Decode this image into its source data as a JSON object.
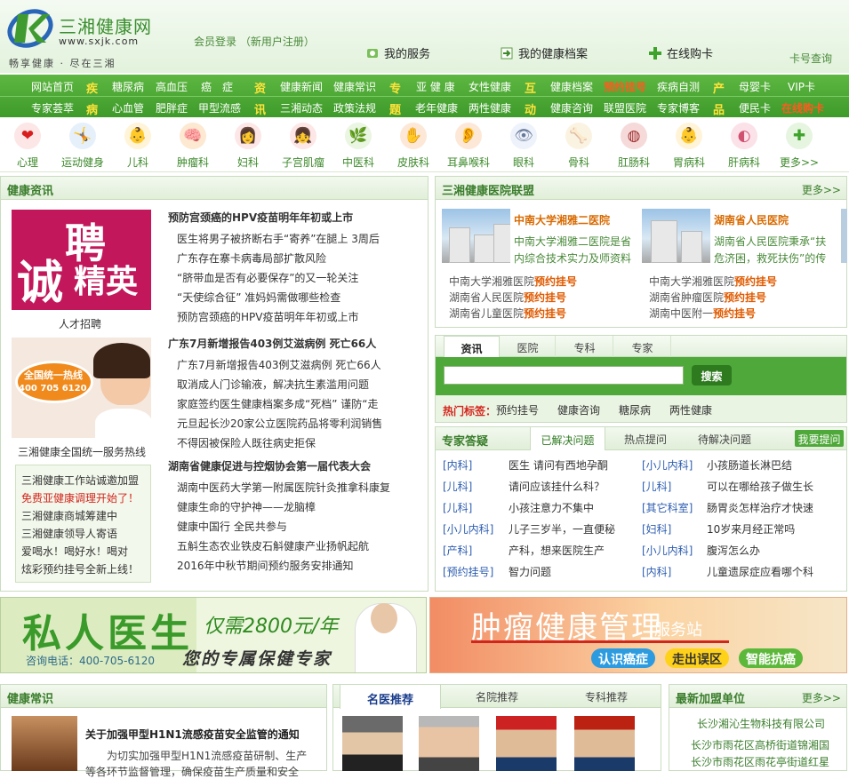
{
  "header": {
    "site_name": "三湘健康网",
    "url_text": "www.sxjk.com",
    "slogan": "畅享健康 · 尽在三湘",
    "member_text": "会员登录 （新用户注册）",
    "links": [
      "我的服务",
      "我的健康档案",
      "在线购卡"
    ],
    "card_query": "卡号查询"
  },
  "nav": {
    "row1": [
      "网站首页",
      "疾",
      "糖尿病",
      "高血压",
      "癌　症",
      "资",
      "健康新闻",
      "健康常识",
      "专",
      "亚 健 康",
      "女性健康",
      "互",
      "健康档案",
      "预约挂号",
      "疾病自测",
      "产",
      "母婴卡",
      "VIP卡"
    ],
    "row2": [
      "专家荟萃",
      "病",
      "心血管",
      "肥胖症",
      "甲型流感",
      "讯",
      "三湘动态",
      "政策法规",
      "题",
      "老年健康",
      "两性健康",
      "动",
      "健康咨询",
      "联盟医院",
      "专家博客",
      "品",
      "便民卡",
      "在线购卡"
    ]
  },
  "departments": [
    {
      "label": "心理",
      "icon": "heart-icon",
      "glyph": "❤"
    },
    {
      "label": "运动健身",
      "icon": "fitness-icon",
      "glyph": "🤸"
    },
    {
      "label": "儿科",
      "icon": "baby-icon",
      "glyph": "👶"
    },
    {
      "label": "肿瘤科",
      "icon": "tumor-icon",
      "glyph": "🧠"
    },
    {
      "label": "妇科",
      "icon": "woman-icon",
      "glyph": "👩"
    },
    {
      "label": "子宫肌瘤",
      "icon": "uterus-icon",
      "glyph": "👧"
    },
    {
      "label": "中医科",
      "icon": "herb-icon",
      "glyph": "🌿"
    },
    {
      "label": "皮肤科",
      "icon": "skin-icon",
      "glyph": "✋"
    },
    {
      "label": "耳鼻喉科",
      "icon": "ear-icon",
      "glyph": "👂"
    },
    {
      "label": "眼科",
      "icon": "eye-icon",
      "glyph": "👁"
    },
    {
      "label": "骨科",
      "icon": "bone-icon",
      "glyph": "🦴"
    },
    {
      "label": "肛肠科",
      "icon": "intestine-icon",
      "glyph": "◍"
    },
    {
      "label": "胃病科",
      "icon": "stomach-icon",
      "glyph": "👶"
    },
    {
      "label": "肝病科",
      "icon": "liver-icon",
      "glyph": "◐"
    },
    {
      "label": "更多>>",
      "icon": "plus-icon",
      "glyph": "✚"
    }
  ],
  "health_news": {
    "title": "健康资讯",
    "recruit": {
      "big1": "聘",
      "big2": "诚",
      "big3": "精英",
      "caption": "人才招聘"
    },
    "hotline": {
      "line1": "全国统一热线",
      "line2": "400 705 6120",
      "caption": "三湘健康全国统一服务热线"
    },
    "notices": [
      {
        "text": "三湘健康工作站诚邀加盟",
        "color": "#333"
      },
      {
        "text": "免费亚健康调理开始了！",
        "color": "#d4251c"
      },
      {
        "text": "三湘健康商城筹建中",
        "color": "#333"
      },
      {
        "text": "三湘健康领导人寄语",
        "color": "#333"
      },
      {
        "text": "爱喝水！喝好水！喝对",
        "color": "#333"
      },
      {
        "text": "炫彩预约挂号全新上线！",
        "color": "#333"
      }
    ],
    "groups": [
      {
        "head": "预防宫颈癌的HPV疫苗明年年初或上市",
        "items": [
          "医生将男子被挤断右手“寄养”在腿上 3周后",
          "广东存在寨卡病毒局部扩散风险",
          "“脐带血是否有必要保存”的又一轮关注",
          "“天使综合征” 准妈妈需做哪些检查",
          "预防宫颈癌的HPV疫苗明年年初或上市"
        ]
      },
      {
        "head": "广东7月新增报告403例艾滋病例 死亡66人",
        "items": [
          "广东7月新增报告403例艾滋病例 死亡66人",
          "取消成人门诊输液，解决抗生素滥用问题",
          "家庭签约医生健康档案多成“死档” 谨防“走",
          "元旦起长沙20家公立医院药品将零利润销售",
          "不得因被保险人既往病史拒保"
        ]
      },
      {
        "head": "湖南省健康促进与控烟协会第一届代表大会",
        "items": [
          "湖南中医药大学第一附属医院针灸推拿科康复",
          "健康生命的守护神——龙脑樟",
          "健康中国行 全民共参与",
          "五斛生态农业铁皮石斛健康产业扬帆起航",
          "2016年中秋节期间预约服务安排通知"
        ]
      }
    ]
  },
  "alliance": {
    "title": "三湘健康医院联盟",
    "more": "更多>>",
    "hospitals": [
      {
        "name": "中南大学湘雅二医院",
        "desc1": "中南大学湘雅二医院是省",
        "desc2": "内综合技术实力及师资料"
      },
      {
        "name": "湖南省人民医院",
        "desc1": "湖南省人民医院秉承“扶",
        "desc2": "危济困，救死扶伤”的传"
      }
    ],
    "booking": [
      [
        "中南大学湘雅医院",
        "中南大学湘雅医院"
      ],
      [
        "湖南省人民医院",
        "湖南省肿瘤医院"
      ],
      [
        "湖南省儿童医院",
        "湖南中医附一"
      ]
    ],
    "booking_label": "预约挂号"
  },
  "search": {
    "tabs": [
      "资讯",
      "医院",
      "专科",
      "专家"
    ],
    "button": "搜索",
    "value": "",
    "hot_label": "热门标签：",
    "hot_tags": [
      "预约挂号",
      "健康咨询",
      "糖尿病",
      "两性健康"
    ]
  },
  "qa": {
    "title": "专家答疑",
    "tabs": [
      "已解决问题",
      "热点提问",
      "待解决问题"
    ],
    "ask_button": "我要提问",
    "left": [
      {
        "cat": "[内科]",
        "q": "医生 请问有西地孕酮"
      },
      {
        "cat": "[儿科]",
        "q": "请问应该挂什么科？"
      },
      {
        "cat": "[儿科]",
        "q": "小孩注意力不集中"
      },
      {
        "cat": "[小儿内科]",
        "q": "儿子三岁半，一直便秘"
      },
      {
        "cat": "[产科]",
        "q": "产科，想来医院生产"
      },
      {
        "cat": "[预约挂号]",
        "q": "智力问题"
      }
    ],
    "right": [
      {
        "cat": "[小儿内科]",
        "q": "小孩肠道长淋巴结"
      },
      {
        "cat": "[儿科]",
        "q": "可以在哪给孩子做生长"
      },
      {
        "cat": "[其它科室]",
        "q": "肠胃炎怎样治疗才快速"
      },
      {
        "cat": "[妇科]",
        "q": "10岁来月经正常吗"
      },
      {
        "cat": "[小儿内科]",
        "q": "腹泻怎么办"
      },
      {
        "cat": "[内科]",
        "q": "儿童遗尿症应看哪个科"
      }
    ]
  },
  "banners": {
    "doctor": {
      "title": "私人医生",
      "price": "仅需2800元/年",
      "phone": "咨询电话：400-705-6120",
      "slogan": "您的专属保健专家"
    },
    "tumor": {
      "title": "肿瘤健康管理",
      "suffix": "服务站",
      "pills": [
        "认识癌症",
        "走出误区",
        "智能抗癌"
      ]
    }
  },
  "common_sense": {
    "title": "健康常识",
    "headline": "关于加强甲型H1N1流感疫苗安全监管的通知",
    "text1": "为切实加强甲型H1N1流感疫苗研制、生产",
    "text2": "等各环节监督管理，确保疫苗生产质量和安全"
  },
  "famous": {
    "tabs": [
      "名医推荐",
      "名院推荐",
      "专科推荐"
    ]
  },
  "new_units": {
    "title": "最新加盟单位",
    "more": "更多>>",
    "items": [
      "长沙湘沁生物科技有限公司",
      "长沙市雨花区高桥街道锦湘国",
      "长沙市雨花区雨花亭街道红星"
    ]
  },
  "colors": {
    "brand_green": "#46a332",
    "link_green": "#3a7d2c",
    "accent_orange": "#e05a00",
    "highlight_yellow": "#ffe33a"
  }
}
